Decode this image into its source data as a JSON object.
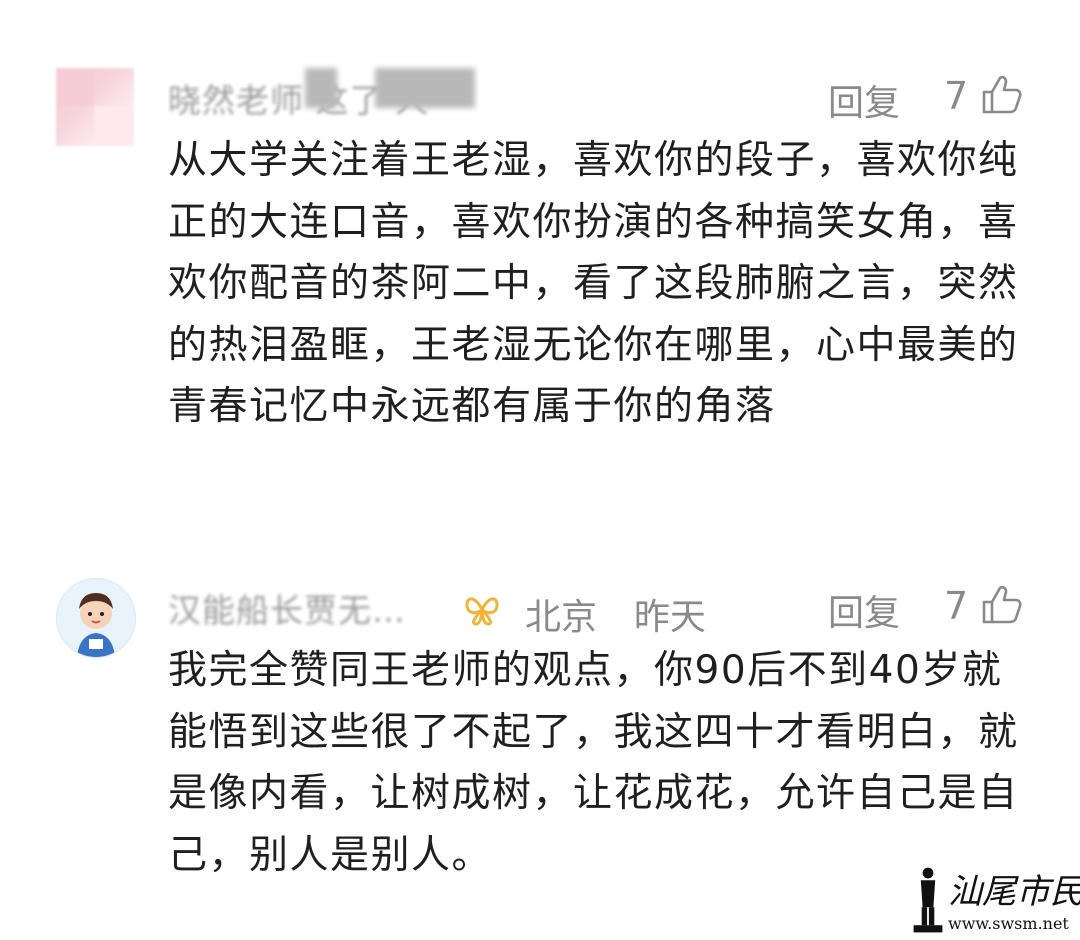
{
  "comments": [
    {
      "username": "晓然老师 这了 人",
      "reply_label": "回复",
      "like_count": "7",
      "text": "从大学关注着王老湿，喜欢你的段子，喜欢你纯正的大连口音，喜欢你扮演的各种搞笑女角，喜欢你配音的茶阿二中，看了这段肺腑之言，突然的热泪盈眶，王老湿无论你在哪里，心中最美的青春记忆中永远都有属于你的角落"
    },
    {
      "username": "汉能船长贾无…",
      "location": "北京",
      "time": "昨天",
      "badge_icon": "butterfly-badge-icon",
      "reply_label": "回复",
      "like_count": "7",
      "text": "我完全赞同王老师的观点，你90后不到40岁就能悟到这些很了不起了，我这四十才看明白，就是像内看，让树成树，让花成花，允许自己是自己，别人是别人。"
    }
  ],
  "watermark": {
    "text": "汕尾市民网",
    "url": "www.swsm.net"
  },
  "colors": {
    "text": "#1f1f1f",
    "meta": "#8a8a8a",
    "badge": "#f0b43a"
  }
}
